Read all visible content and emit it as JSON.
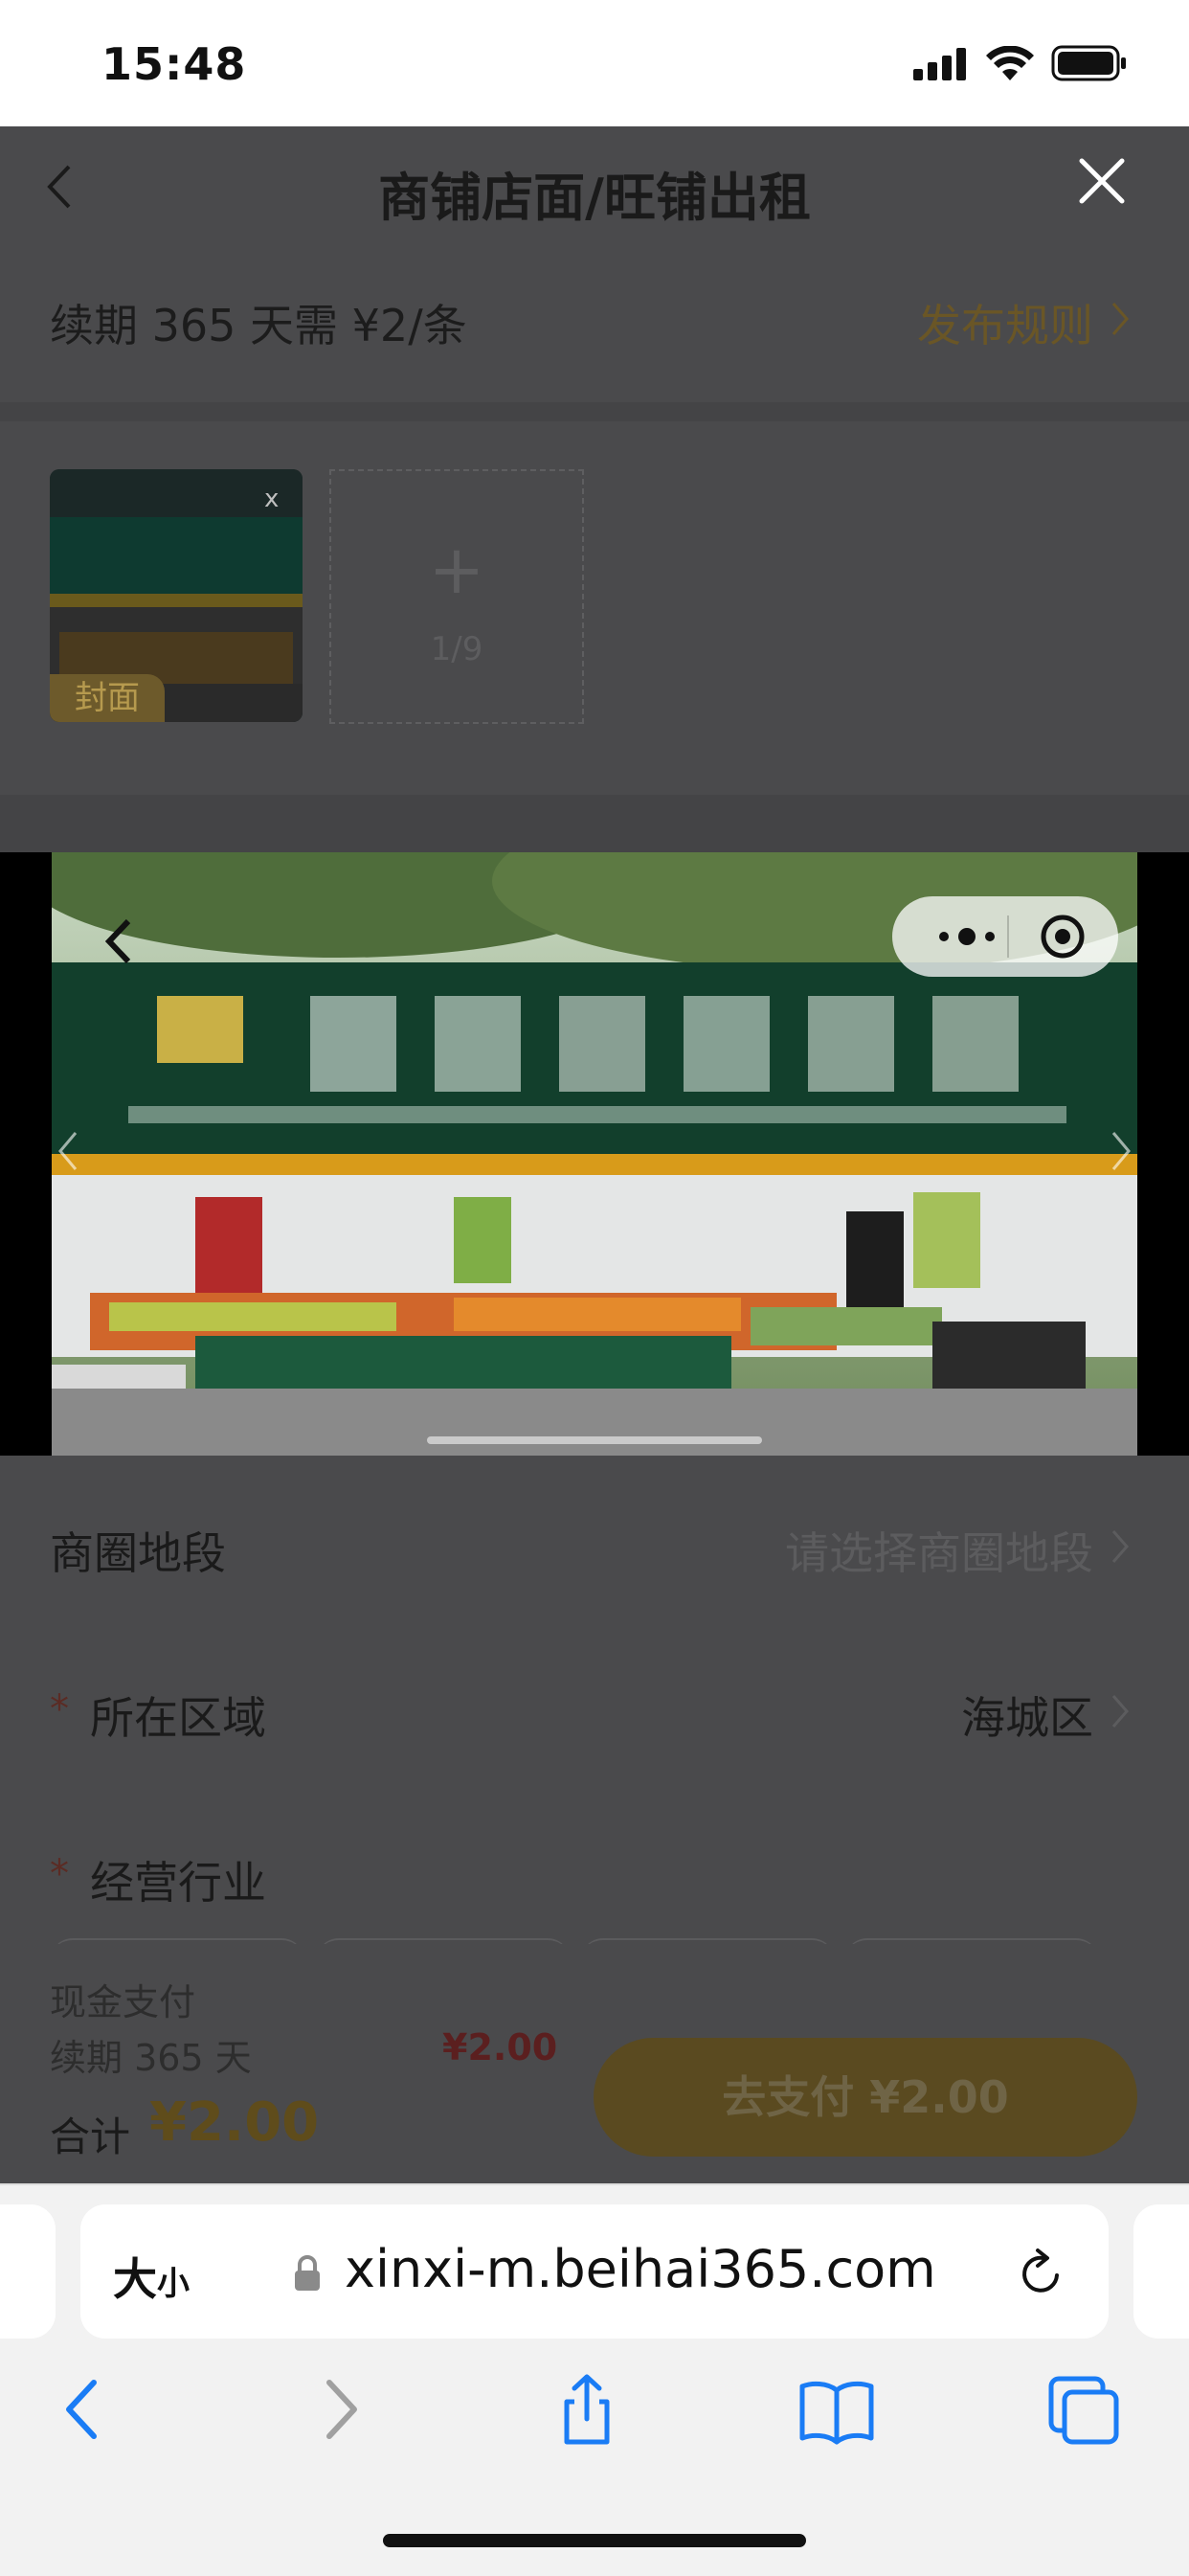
{
  "status_bar": {
    "time": "15:48"
  },
  "header": {
    "title": "商铺店面/旺铺出租"
  },
  "notice": {
    "renew_text": "续期 365 天需 ¥2/条",
    "rule_link": "发布规则"
  },
  "images": {
    "cover_label": "封面",
    "remove_mark": "x",
    "add_symbol": "+",
    "count": "1/9"
  },
  "form": {
    "business_area": {
      "label": "商圈地段",
      "placeholder": "请选择商圈地段"
    },
    "district": {
      "required": "*",
      "label": "所在区域",
      "value": "海城区"
    },
    "industry": {
      "required": "*",
      "label": "经营行业"
    }
  },
  "payment": {
    "method": "现金支付",
    "renew_line": "续期 365 天",
    "renew_price": "¥2.00",
    "total_label": "合计",
    "total_value": "¥2.00",
    "pay_button": "去支付 ¥2.00"
  },
  "browser": {
    "text_size_big": "大",
    "text_size_small": "小",
    "url": "xinxi-m.beihai365.com"
  },
  "colors": {
    "accent": "#f5c12e",
    "price_red": "#e0463f",
    "blue": "#1a7cf5"
  }
}
